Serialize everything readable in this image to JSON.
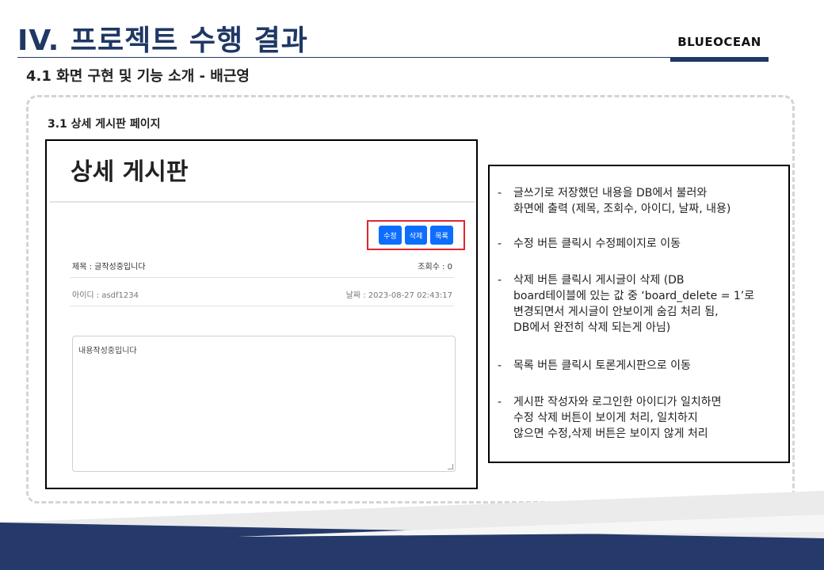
{
  "header": {
    "title": "IV. 프로젝트 수행 결과",
    "brand": "BLUEOCEAN",
    "subtitle": "4.1 화면 구현 및 기능 소개 - 배근영"
  },
  "section": {
    "label": "3.1 상세 게시판 페이지"
  },
  "screenshot": {
    "heading": "상세 게시판",
    "buttons": {
      "edit": "수정",
      "delete": "삭제",
      "list": "목록"
    },
    "post": {
      "title_text": "제목 : 글작성중입니다",
      "views_text": "조회수 : 0",
      "author_text": "아이디 : asdf1234",
      "date_text": "날짜 : 2023-08-27 02:43:17",
      "content": "내용작성중입니다"
    }
  },
  "description": {
    "bullet_marker": "-",
    "bullets": [
      {
        "lines": [
          "글쓰기로 저장했던 내용을 DB에서 불러와",
          "화면에 출력 (제목, 조회수, 아이디, 날짜, 내용)"
        ]
      },
      {
        "lines": [
          "수정 버튼 클릭시 수정페이지로 이동"
        ]
      },
      {
        "lines": [
          "삭제 버튼 클릭시 게시글이 삭제 (DB",
          "board테이블에 있는 값 중 ‘board_delete = 1’로",
          "변경되면서 게시글이 안보이게 숨김 처리 됨,",
          "DB에서 완전히 삭제 되는게 아님)"
        ]
      },
      {
        "lines": [
          "목록 버튼 클릭시 토론게시판으로 이동"
        ]
      },
      {
        "lines": [
          "게시판 작성자와 로그인한 아이디가 일치하면",
          "수정 삭제 버튼이 보이게 처리, 일치하지",
          "않으면 수정,삭제 버튼은 보이지 않게 처리"
        ]
      }
    ]
  },
  "colors": {
    "title": "#1f3864",
    "button": "#0d6efd",
    "highlight_border": "#e0252f",
    "footer_navy": "#253a6a",
    "footer_light": "#e8e8e8"
  }
}
